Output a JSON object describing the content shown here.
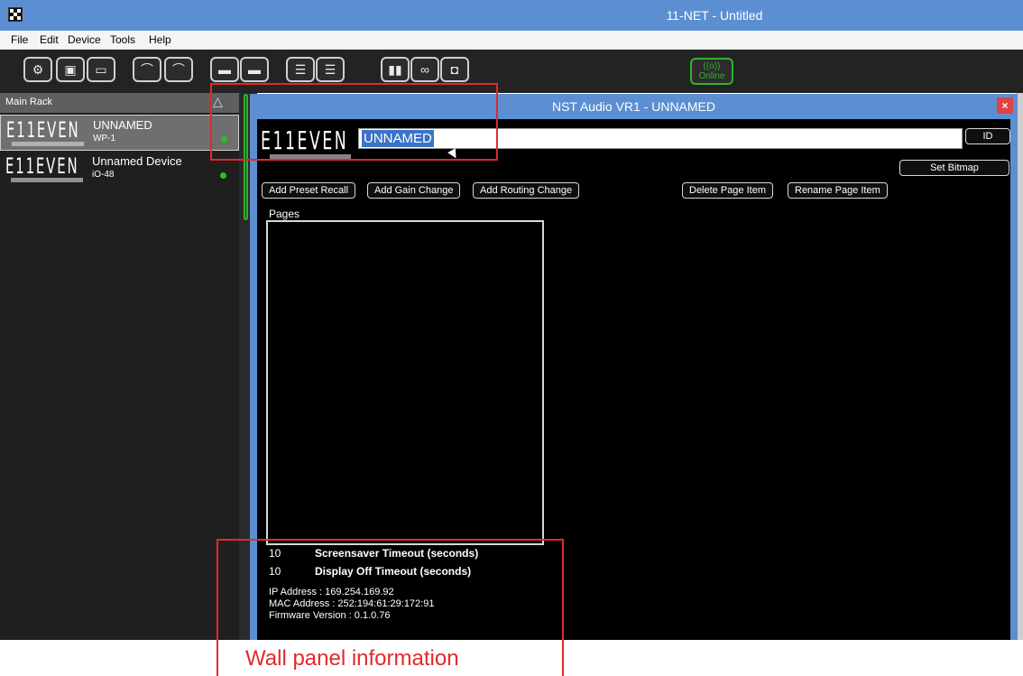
{
  "window": {
    "title": "11-NET - Untitled"
  },
  "menu": {
    "items": [
      "File",
      "Edit",
      "Device",
      "Tools",
      "Help"
    ]
  },
  "toolbar": {
    "online_label": "Online",
    "online_icon": "((o))"
  },
  "rack": {
    "header": "Main Rack",
    "devices": [
      {
        "logo": "E11EVEN",
        "name": "UNNAMED",
        "model": "WP-1",
        "status_color": "#22c422"
      },
      {
        "logo": "E11EVEN",
        "name": "Unnamed Device",
        "model": "iO-48",
        "status_color": "#22c422"
      }
    ]
  },
  "dialog": {
    "title": "NST Audio VR1 - UNNAMED",
    "close_label": "×",
    "logo": "E11EVEN",
    "name_value": "UNNAMED",
    "id_button": "ID",
    "set_bitmap_button": "Set Bitmap",
    "buttons": {
      "add_preset_recall": "Add Preset Recall",
      "add_gain_change": "Add Gain Change",
      "add_routing_change": "Add Routing Change",
      "delete_page_item": "Delete Page Item",
      "rename_page_item": "Rename Page Item"
    },
    "pages_label": "Pages",
    "settings": [
      {
        "value": "10",
        "label": "Screensaver Timeout (seconds)"
      },
      {
        "value": "10",
        "label": "Display Off Timeout (seconds)"
      }
    ],
    "info": {
      "ip": "IP Address : 169.254.169.92",
      "mac": "MAC Address : 252:194:61:29:172:91",
      "firmware": "Firmware Version : 0.1.0.76"
    }
  },
  "annotation": {
    "label": "Wall panel information",
    "color": "#e02a2a"
  }
}
